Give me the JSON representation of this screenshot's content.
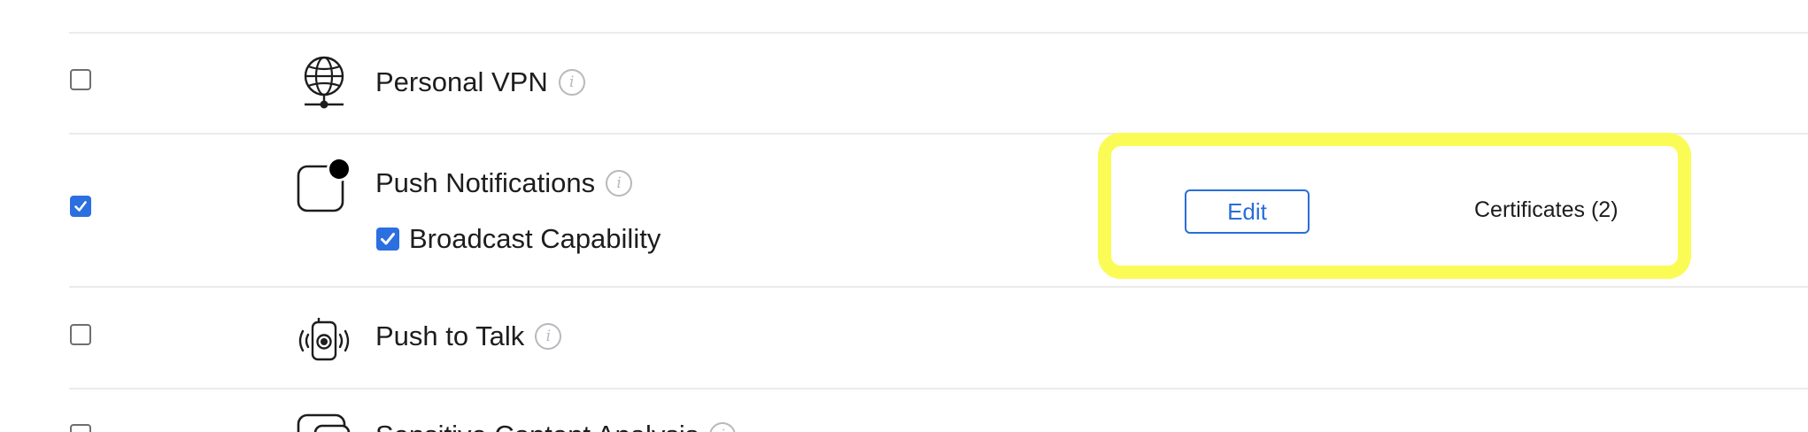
{
  "capabilities": [
    {
      "name": "Personal VPN",
      "checked": false,
      "icon": "globe-network-icon"
    },
    {
      "name": "Push Notifications",
      "checked": true,
      "icon": "push-notification-icon",
      "sub_option": {
        "label": "Broadcast Capability",
        "checked": true
      },
      "edit_label": "Edit",
      "certificates_label": "Certificates (2)"
    },
    {
      "name": "Push to Talk",
      "checked": false,
      "icon": "walkie-talkie-icon"
    },
    {
      "name": "Sensitive Content Analysis",
      "checked": false,
      "icon": "sensitive-content-icon"
    }
  ],
  "info_glyph": "i",
  "colors": {
    "accent": "#2b6fe0",
    "highlight": "#fbfb56",
    "divider": "#ebebed"
  }
}
